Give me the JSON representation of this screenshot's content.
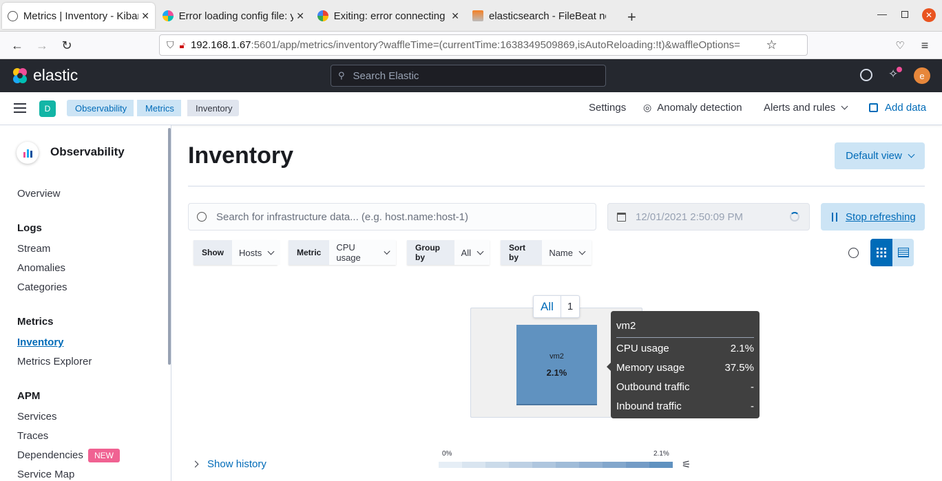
{
  "browser": {
    "tabs": [
      {
        "title": "Metrics | Inventory - Kibana",
        "active": true
      },
      {
        "title": "Error loading config file: y",
        "active": false
      },
      {
        "title": "Exiting: error connecting",
        "active": false
      },
      {
        "title": "elasticsearch - FileBeat no",
        "active": false
      }
    ],
    "url_host": "192.168.1.67",
    "url_rest": ":5601/app/metrics/inventory?waffleTime=(currentTime:1638349509869,isAutoReloading:!t)&waffleOptions="
  },
  "header": {
    "brand": "elastic",
    "search_placeholder": "Search Elastic",
    "user_initial": "e"
  },
  "subheader": {
    "space_initial": "D",
    "breadcrumbs": [
      "Observability",
      "Metrics",
      "Inventory"
    ],
    "settings": "Settings",
    "anomaly": "Anomaly detection",
    "alerts": "Alerts and rules",
    "add_data": "Add data"
  },
  "sidebar": {
    "title": "Observability",
    "overview": "Overview",
    "logs": {
      "heading": "Logs",
      "items": [
        "Stream",
        "Anomalies",
        "Categories"
      ]
    },
    "metrics": {
      "heading": "Metrics",
      "items": [
        "Inventory",
        "Metrics Explorer"
      ]
    },
    "apm": {
      "heading": "APM",
      "items": [
        "Services",
        "Traces",
        "Dependencies",
        "Service Map"
      ],
      "badge": "NEW"
    }
  },
  "main": {
    "title": "Inventory",
    "default_view": "Default view",
    "search_placeholder": "Search for infrastructure data... (e.g. host.name:host-1)",
    "date": "12/01/2021 2:50:09 PM",
    "stop_refreshing": "Stop refreshing",
    "filters": [
      {
        "label": "Show",
        "value": "Hosts"
      },
      {
        "label": "Metric",
        "value": "CPU usage"
      },
      {
        "label": "Group by",
        "value": "All"
      },
      {
        "label": "Sort by",
        "value": "Name"
      }
    ],
    "group": {
      "label": "All",
      "count": "1"
    },
    "node": {
      "name": "vm2",
      "value": "2.1%",
      "color": "#6092c0"
    },
    "tooltip": {
      "title": "vm2",
      "rows": [
        {
          "label": "CPU usage",
          "value": "2.1%"
        },
        {
          "label": "Memory usage",
          "value": "37.5%"
        },
        {
          "label": "Outbound traffic",
          "value": "-"
        },
        {
          "label": "Inbound traffic",
          "value": "-"
        }
      ]
    },
    "show_history": "Show history",
    "legend": {
      "min": "0%",
      "max": "2.1%"
    }
  },
  "colors": {
    "accent": "#006bb8",
    "header_bg": "#25282f",
    "badge": "#f06292"
  }
}
